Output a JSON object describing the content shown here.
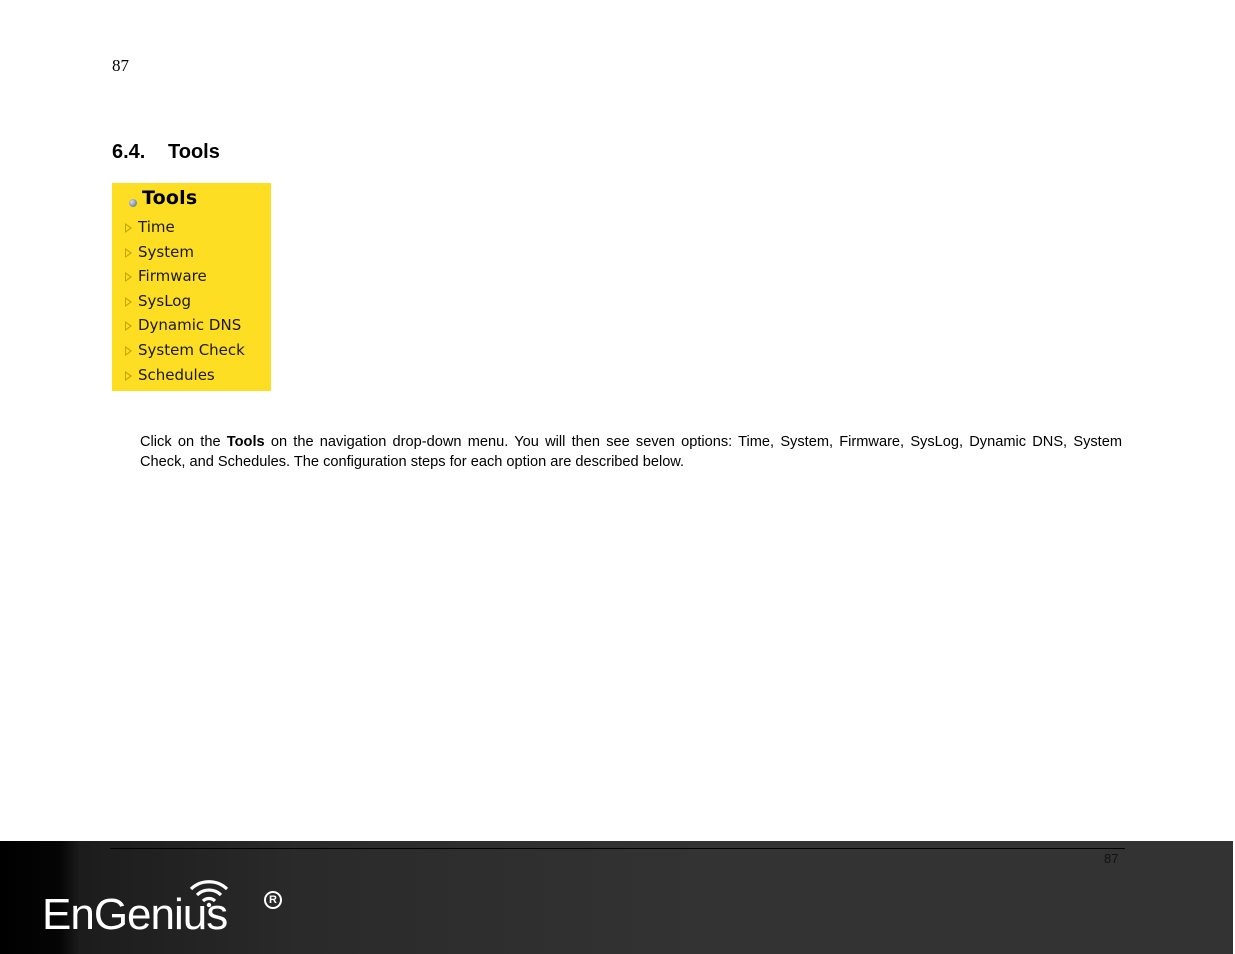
{
  "page": {
    "number_top": "87",
    "number_footer": "87"
  },
  "section": {
    "number": "6.4.",
    "title": "Tools"
  },
  "tools_menu": {
    "title": "Tools",
    "background_color": "#fede22",
    "items": [
      {
        "label": "Time"
      },
      {
        "label": "System"
      },
      {
        "label": "Firmware"
      },
      {
        "label": "SysLog"
      },
      {
        "label": "Dynamic DNS"
      },
      {
        "label": "System Check"
      },
      {
        "label": "Schedules"
      }
    ]
  },
  "body": {
    "part1": "Click on the ",
    "bold": "Tools",
    "part2": " on the navigation drop-down menu. You will then see seven options: Time, System, Firmware, SysLog, Dynamic DNS, System Check, and Schedules. The configuration steps for each option are described below."
  },
  "footer": {
    "brand": "EnGenius",
    "registered_mark": "R"
  }
}
